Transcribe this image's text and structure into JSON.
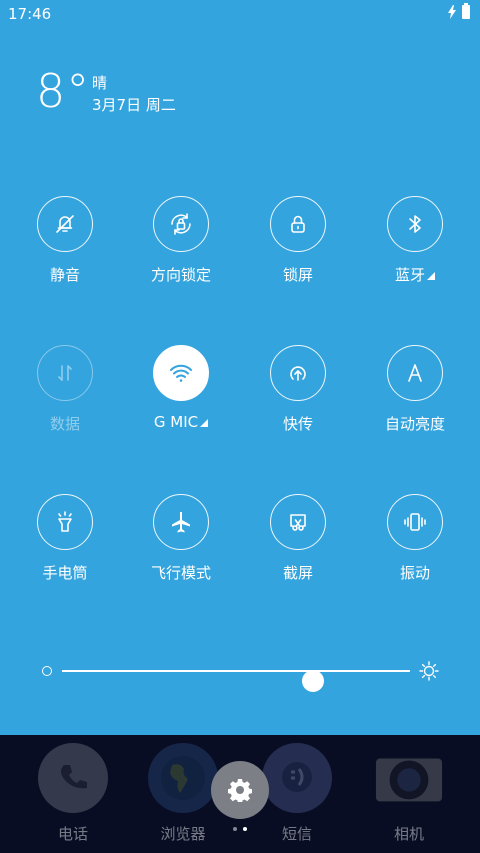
{
  "status_bar": {
    "time": "17:46"
  },
  "weather": {
    "temperature": "8°",
    "condition": "晴",
    "date": "3月7日 周二"
  },
  "tiles": [
    {
      "label": "静音"
    },
    {
      "label": "方向锁定"
    },
    {
      "label": "锁屏"
    },
    {
      "label": "蓝牙"
    },
    {
      "label": "数据"
    },
    {
      "label": "G   MIC"
    },
    {
      "label": "快传"
    },
    {
      "label": "自动亮度"
    },
    {
      "label": "手电筒"
    },
    {
      "label": "飞行模式"
    },
    {
      "label": "截屏"
    },
    {
      "label": "振动"
    }
  ],
  "brightness": {
    "level": 0.72
  },
  "dock": [
    {
      "label": "电话"
    },
    {
      "label": "浏览器"
    },
    {
      "label": "短信"
    },
    {
      "label": "相机"
    }
  ],
  "colors": {
    "panel": "#34a4de",
    "dock": "#090d24",
    "active_icon": "#34a4de"
  },
  "icons": [
    "bell-off-icon",
    "rotation-lock-icon",
    "lock-icon",
    "bluetooth-icon",
    "data-icon",
    "wifi-icon",
    "transfer-icon",
    "auto-brightness-icon",
    "flashlight-icon",
    "airplane-icon",
    "screenshot-icon",
    "vibrate-icon",
    "settings-gear-icon"
  ]
}
